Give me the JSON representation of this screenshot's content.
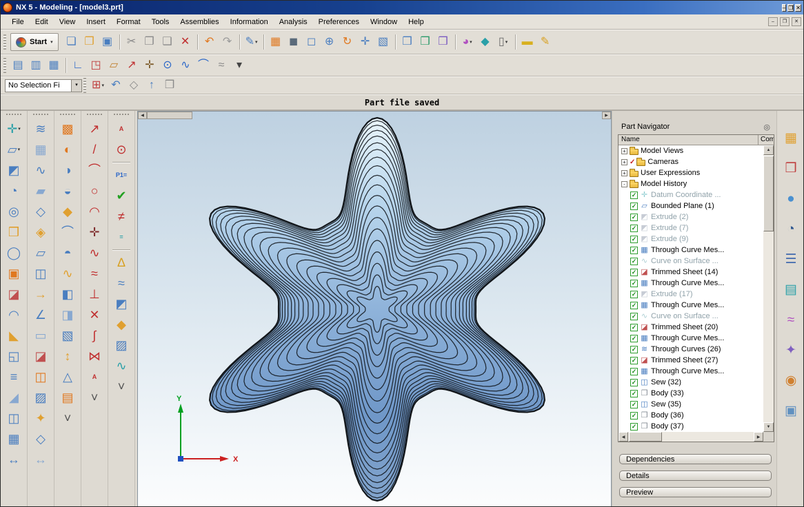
{
  "titlebar": {
    "title": "NX 5 - Modeling - [model3.prt]",
    "window_buttons": [
      {
        "n": "minimize-button",
        "g": "–"
      },
      {
        "n": "maximize-button",
        "g": "❐"
      },
      {
        "n": "close-button",
        "g": "✕"
      }
    ]
  },
  "menubar": {
    "items": [
      "File",
      "Edit",
      "View",
      "Insert",
      "Format",
      "Tools",
      "Assemblies",
      "Information",
      "Analysis",
      "Preferences",
      "Window",
      "Help"
    ],
    "child_buttons": [
      {
        "n": "child-minimize-button",
        "g": "–"
      },
      {
        "n": "child-restore-button",
        "g": "❐"
      },
      {
        "n": "child-close-button",
        "g": "✕"
      }
    ]
  },
  "toolbar_main": {
    "start_label": "Start",
    "start_arrow": "▾",
    "icons": [
      {
        "n": "new-file",
        "g": "❏",
        "c": "#4a7ec0"
      },
      {
        "n": "open-file",
        "g": "❐",
        "c": "#e0a030"
      },
      {
        "n": "save",
        "g": "▣",
        "c": "#4a7ec0"
      },
      {
        "sep": true
      },
      {
        "n": "cut",
        "g": "✂",
        "c": "#8a8a8a"
      },
      {
        "n": "copy",
        "g": "❐",
        "c": "#8a8a8a"
      },
      {
        "n": "paste",
        "g": "❑",
        "c": "#8a8a8a"
      },
      {
        "n": "delete",
        "g": "✕",
        "c": "#c03030"
      },
      {
        "sep": true
      },
      {
        "n": "undo",
        "g": "↶",
        "c": "#e07820"
      },
      {
        "n": "redo",
        "g": "↷",
        "c": "#9a9a9a"
      },
      {
        "sep": true
      },
      {
        "n": "direct-sketch",
        "g": "✎",
        "c": "#4a7ec0",
        "d": true
      },
      {
        "sep": true
      },
      {
        "n": "object-display",
        "g": "▦",
        "c": "#e07820"
      },
      {
        "n": "shaded-display",
        "g": "◼",
        "c": "#5a6a7a"
      },
      {
        "n": "zoom-window",
        "g": "◻",
        "c": "#4a7ec0"
      },
      {
        "n": "zoom-in-out",
        "g": "⊕",
        "c": "#4a7ec0"
      },
      {
        "n": "rotate-view",
        "g": "↻",
        "c": "#e07820"
      },
      {
        "n": "pan-view",
        "g": "✛",
        "c": "#4a7ec0"
      },
      {
        "n": "fit-view",
        "g": "▧",
        "c": "#4a7ec0"
      },
      {
        "sep": true
      },
      {
        "n": "assembly-constraints",
        "g": "❒",
        "c": "#4a7ec0"
      },
      {
        "n": "move-component",
        "g": "❒",
        "c": "#2a9a6a"
      },
      {
        "n": "add-component",
        "g": "❒",
        "c": "#7a5ac0"
      },
      {
        "sep": true
      },
      {
        "n": "rendering-style",
        "g": "◕",
        "c": "#b050c0",
        "d": true
      },
      {
        "n": "shaded-solid",
        "g": "◆",
        "c": "#2aa0a8"
      },
      {
        "n": "display-mode",
        "g": "▯",
        "c": "#6a6a6a",
        "d": true
      },
      {
        "sep": true
      },
      {
        "n": "measure-distance",
        "g": "▬",
        "c": "#d8b020"
      },
      {
        "n": "simple-interference",
        "g": "✎",
        "c": "#d8a020"
      }
    ]
  },
  "toolbar_second": {
    "icons": [
      {
        "n": "view-layout-one",
        "g": "▤",
        "c": "#4a7ec0"
      },
      {
        "n": "view-layout-two",
        "g": "▥",
        "c": "#4a7ec0"
      },
      {
        "n": "view-layout-four",
        "g": "▦",
        "c": "#4a7ec0"
      },
      {
        "sep": true
      },
      {
        "n": "sketch",
        "g": "∟",
        "c": "#2a66c8"
      },
      {
        "n": "sketch-in-task",
        "g": "◳",
        "c": "#c04040"
      },
      {
        "n": "datum-plane",
        "g": "▱",
        "c": "#c08030"
      },
      {
        "n": "datum-axis",
        "g": "↗",
        "c": "#c03030"
      },
      {
        "n": "point",
        "g": "✛",
        "c": "#806030"
      },
      {
        "n": "point-origin",
        "g": "⊙",
        "c": "#2a66c8"
      },
      {
        "n": "studio-spline",
        "g": "∿",
        "c": "#2a66c8"
      },
      {
        "n": "arc",
        "g": "⌒",
        "c": "#2a66c8"
      },
      {
        "n": "offset-curve",
        "g": "≈",
        "c": "#8a8a8a"
      },
      {
        "n": "more-curve-tools",
        "g": "▾",
        "c": "#444444"
      }
    ]
  },
  "selection_bar": {
    "filter_value": "No Selection Fi",
    "combo_arrow": "▾",
    "icons": [
      {
        "n": "snap-point",
        "g": "⊞",
        "c": "#c04040",
        "d": true
      },
      {
        "n": "undo-selection",
        "g": "↶",
        "c": "#4a7ec0"
      },
      {
        "n": "work-section",
        "g": "◇",
        "c": "#8a8a8a"
      },
      {
        "n": "orient-view",
        "g": "↑",
        "c": "#4a7ec0"
      },
      {
        "n": "selection-scope",
        "g": "❒",
        "c": "#8a8a8a"
      }
    ]
  },
  "status_bar": {
    "message": "Part file saved"
  },
  "toolbox": {
    "columns": [
      {
        "icons": [
          {
            "n": "datum-csys",
            "g": "✛",
            "c": "#2aa0a8",
            "d": true
          },
          {
            "n": "sketch-feature",
            "g": "▱",
            "c": "#4a7ec0",
            "d": true
          },
          {
            "n": "extrude",
            "g": "◩",
            "c": "#4a7ec0"
          },
          {
            "n": "revolve",
            "g": "◔",
            "c": "#4a7ec0"
          },
          {
            "n": "hole",
            "g": "◎",
            "c": "#4a7ec0"
          },
          {
            "n": "block",
            "g": "❒",
            "c": "#e0a030"
          },
          {
            "n": "cylinder",
            "g": "◯",
            "c": "#4a7ec0"
          },
          {
            "n": "unite",
            "g": "▣",
            "c": "#e07820"
          },
          {
            "n": "subtract",
            "g": "◪",
            "c": "#c05050"
          },
          {
            "n": "edge-blend",
            "g": "◠",
            "c": "#4a7ec0"
          },
          {
            "n": "chamfer",
            "g": "◣",
            "c": "#e0a030"
          },
          {
            "n": "shell",
            "g": "◱",
            "c": "#4a7ec0"
          },
          {
            "n": "thicken",
            "g": "≡",
            "c": "#4a7ec0"
          },
          {
            "n": "draft",
            "g": "◢",
            "c": "#88a8d0"
          },
          {
            "n": "mirror-feature",
            "g": "◫",
            "c": "#4a7ec0"
          },
          {
            "n": "pattern-feature",
            "g": "▦",
            "c": "#4a7ec0"
          },
          {
            "n": "move-face",
            "g": "↔",
            "c": "#4a7ec0"
          }
        ]
      },
      {
        "icons": [
          {
            "n": "through-curves",
            "g": "≋",
            "c": "#4a7ec0"
          },
          {
            "n": "through-curve-mesh",
            "g": "▦",
            "c": "#88a8d0"
          },
          {
            "n": "swept",
            "g": "∿",
            "c": "#4a7ec0"
          },
          {
            "n": "ruled-surface",
            "g": "▰",
            "c": "#88a8d0"
          },
          {
            "n": "n-sided-surface",
            "g": "◇",
            "c": "#4a7ec0"
          },
          {
            "n": "studio-surface",
            "g": "◈",
            "c": "#e0a030"
          },
          {
            "n": "bounded-plane",
            "g": "▱",
            "c": "#4a7ec0"
          },
          {
            "n": "offset-surface",
            "g": "◫",
            "c": "#4a7ec0"
          },
          {
            "n": "extension-surface",
            "g": "→",
            "c": "#e0a030"
          },
          {
            "n": "law-extension",
            "g": "∠",
            "c": "#4a7ec0"
          },
          {
            "n": "sheet-body",
            "g": "▭",
            "c": "#88a8d0"
          },
          {
            "n": "trimmed-sheet",
            "g": "◪",
            "c": "#c05050"
          },
          {
            "n": "sew",
            "g": "◫",
            "c": "#e07820"
          },
          {
            "n": "patch-body",
            "g": "▨",
            "c": "#4a7ec0"
          },
          {
            "n": "x-form",
            "g": "✦",
            "c": "#e0a030"
          },
          {
            "n": "i-form",
            "g": "◇",
            "c": "#4a7ec0"
          },
          {
            "n": "edge-symmetry",
            "g": "↔",
            "c": "#88a8d0"
          }
        ]
      },
      {
        "icons": [
          {
            "n": "fill-surface",
            "g": "▩",
            "c": "#e07820"
          },
          {
            "n": "face-blend",
            "g": "◐",
            "c": "#e07820"
          },
          {
            "n": "styled-blend",
            "g": "◑",
            "c": "#4a7ec0"
          },
          {
            "n": "soft-blend",
            "g": "◒",
            "c": "#4a7ec0"
          },
          {
            "n": "styled-corner",
            "g": "◆",
            "c": "#e0a030"
          },
          {
            "n": "silhouette-flange",
            "g": "⌒",
            "c": "#4a7ec0"
          },
          {
            "n": "global-shaping",
            "g": "◓",
            "c": "#4a7ec0"
          },
          {
            "n": "swoop",
            "g": "∿",
            "c": "#e0a030"
          },
          {
            "n": "emboss-body",
            "g": "◧",
            "c": "#4a7ec0"
          },
          {
            "n": "offset-emboss",
            "g": "◨",
            "c": "#88a8d0"
          },
          {
            "n": "refit-face",
            "g": "▧",
            "c": "#4a7ec0"
          },
          {
            "n": "scale-body",
            "g": "↕",
            "c": "#e0a030"
          },
          {
            "n": "wrap-geometry",
            "g": "△",
            "c": "#4a7ec0"
          },
          {
            "n": "quilt",
            "g": "▤",
            "c": "#e07820"
          },
          {
            "n": "more-surface-tools",
            "g": "˅",
            "c": "#555555"
          }
        ]
      },
      {
        "icons": [
          {
            "n": "profile",
            "g": "↗",
            "c": "#c03030"
          },
          {
            "n": "line",
            "g": "/",
            "c": "#c03030"
          },
          {
            "n": "arc-circle",
            "g": "⌒",
            "c": "#c03030"
          },
          {
            "n": "circle",
            "g": "○",
            "c": "#c03030"
          },
          {
            "n": "fillet",
            "g": "◠",
            "c": "#c03030"
          },
          {
            "n": "point-on-curve",
            "g": "✛",
            "c": "#803030"
          },
          {
            "n": "spline",
            "g": "∿",
            "c": "#c03030"
          },
          {
            "n": "offset-curve-tool",
            "g": "≈",
            "c": "#c03030"
          },
          {
            "n": "project-curve",
            "g": "⊥",
            "c": "#c03030"
          },
          {
            "n": "intersection-curve",
            "g": "✕",
            "c": "#c03030"
          },
          {
            "n": "section-curve",
            "g": "∫",
            "c": "#c03030"
          },
          {
            "n": "join-curve",
            "g": "⋈",
            "c": "#c03030"
          },
          {
            "n": "text-curve",
            "g": "A",
            "c": "#c03030",
            "t": true
          },
          {
            "n": "more-curve-tools-column",
            "g": "˅",
            "c": "#555555"
          }
        ]
      },
      {
        "icons": [
          {
            "n": "annotation-text",
            "g": "A",
            "c": "#c03030",
            "t": true
          },
          {
            "n": "point-tool",
            "g": "⊙",
            "c": "#c03030"
          },
          {
            "sep": true
          },
          {
            "n": "expression",
            "g": "P1=",
            "c": "#2a66c8",
            "t": true
          },
          {
            "n": "expression-check",
            "g": "✔",
            "c": "#22a020"
          },
          {
            "n": "requirement-unmet",
            "g": "≠",
            "c": "#c03030"
          },
          {
            "n": "equal-constraint",
            "g": "=",
            "c": "#2aa0a8",
            "t": true
          },
          {
            "sep": true
          },
          {
            "n": "measure-body",
            "g": "∆",
            "c": "#d8a020"
          },
          {
            "n": "deviation-gauge",
            "g": "≈",
            "c": "#4a7ec0"
          },
          {
            "n": "reflection-analysis",
            "g": "◩",
            "c": "#4a7ec0"
          },
          {
            "n": "draft-analysis",
            "g": "◆",
            "c": "#e0a030"
          },
          {
            "n": "face-analysis",
            "g": "▨",
            "c": "#4a7ec0"
          },
          {
            "n": "curve-analysis",
            "g": "∿",
            "c": "#2aa0a8"
          },
          {
            "n": "more-analysis-tools",
            "g": "˅",
            "c": "#555555"
          }
        ]
      }
    ]
  },
  "viewport": {
    "axes": {
      "x": "X",
      "y": "Y"
    },
    "pane_arrows": {
      "left": "◀",
      "right": "▶"
    }
  },
  "navigator": {
    "title": "Part Navigator",
    "pin_icon": "◎",
    "columns": [
      "Name",
      "Com"
    ],
    "scroll": {
      "up": "▲",
      "down": "▼",
      "left": "◀",
      "right": "▶"
    },
    "tree": [
      {
        "n": "tree-model-views",
        "label": "Model Views",
        "level": 0,
        "expand": "+",
        "g": "folder"
      },
      {
        "n": "tree-cameras",
        "label": "Cameras",
        "level": 0,
        "expand": "+",
        "check": "red",
        "g": "folder"
      },
      {
        "n": "tree-user-expressions",
        "label": "User Expressions",
        "level": 0,
        "expand": "+",
        "g": "folder"
      },
      {
        "n": "tree-model-history",
        "label": "Model History",
        "level": 0,
        "expand": "-",
        "g": "folder-open"
      },
      {
        "n": "tree-datum-coordinate",
        "label": "Datum Coordinate ...",
        "level": 1,
        "check": "green",
        "g": "✛",
        "c": "#2aa0a8",
        "gray": true
      },
      {
        "n": "tree-bounded-plane-1",
        "label": "Bounded Plane (1)",
        "level": 1,
        "check": "green",
        "g": "▱",
        "c": "#4a7ec0"
      },
      {
        "n": "tree-extrude-2",
        "label": "Extrude (2)",
        "level": 1,
        "check": "green",
        "g": "◩",
        "c": "#9aa4b4",
        "gray": true
      },
      {
        "n": "tree-extrude-7",
        "label": "Extrude (7)",
        "level": 1,
        "check": "green",
        "g": "◩",
        "c": "#9aa4b4",
        "gray": true
      },
      {
        "n": "tree-extrude-9",
        "label": "Extrude (9)",
        "level": 1,
        "check": "green",
        "g": "◩",
        "c": "#9aa4b4",
        "gray": true
      },
      {
        "n": "tree-through-curve-mesh-a",
        "label": "Through Curve Mes...",
        "level": 1,
        "check": "green",
        "g": "▦",
        "c": "#4a7ec0"
      },
      {
        "n": "tree-curve-on-surface-a",
        "label": "Curve on Surface ...",
        "level": 1,
        "check": "green",
        "g": "∿",
        "c": "#6aa8b0",
        "gray": true
      },
      {
        "n": "tree-trimmed-sheet-14",
        "label": "Trimmed Sheet (14)",
        "level": 1,
        "check": "green",
        "g": "◪",
        "c": "#c05050"
      },
      {
        "n": "tree-through-curve-mesh-b",
        "label": "Through Curve Mes...",
        "level": 1,
        "check": "green",
        "g": "▦",
        "c": "#4a7ec0"
      },
      {
        "n": "tree-extrude-17",
        "label": "Extrude (17)",
        "level": 1,
        "check": "green",
        "g": "◩",
        "c": "#9aa4b4",
        "gray": true
      },
      {
        "n": "tree-through-curve-mesh-c",
        "label": "Through Curve Mes...",
        "level": 1,
        "check": "green",
        "g": "▦",
        "c": "#4a7ec0"
      },
      {
        "n": "tree-curve-on-surface-b",
        "label": "Curve on Surface ...",
        "level": 1,
        "check": "green",
        "g": "∿",
        "c": "#6aa8b0",
        "gray": true
      },
      {
        "n": "tree-trimmed-sheet-20",
        "label": "Trimmed Sheet (20)",
        "level": 1,
        "check": "green",
        "g": "◪",
        "c": "#c05050"
      },
      {
        "n": "tree-through-curve-mesh-d",
        "label": "Through Curve Mes...",
        "level": 1,
        "check": "green",
        "g": "▦",
        "c": "#4a7ec0"
      },
      {
        "n": "tree-through-curves-26",
        "label": "Through Curves (26)",
        "level": 1,
        "check": "green",
        "g": "≋",
        "c": "#4a7ec0"
      },
      {
        "n": "tree-trimmed-sheet-27",
        "label": "Trimmed Sheet (27)",
        "level": 1,
        "check": "green",
        "g": "◪",
        "c": "#c05050"
      },
      {
        "n": "tree-through-curve-mesh-e",
        "label": "Through Curve Mes...",
        "level": 1,
        "check": "green",
        "g": "▦",
        "c": "#4a7ec0"
      },
      {
        "n": "tree-sew-32",
        "label": "Sew (32)",
        "level": 1,
        "check": "green",
        "g": "◫",
        "c": "#4a7ec0"
      },
      {
        "n": "tree-body-33",
        "label": "Body (33)",
        "level": 1,
        "check": "green",
        "g": "❒",
        "c": "#808890"
      },
      {
        "n": "tree-sew-35",
        "label": "Sew (35)",
        "level": 1,
        "check": "green",
        "g": "◫",
        "c": "#4a7ec0"
      },
      {
        "n": "tree-body-36",
        "label": "Body (36)",
        "level": 1,
        "check": "green",
        "g": "❒",
        "c": "#808890"
      },
      {
        "n": "tree-body-37",
        "label": "Body (37)",
        "level": 1,
        "check": "green",
        "g": "❒",
        "c": "#808890"
      }
    ],
    "panels": [
      "Dependencies",
      "Details",
      "Preview"
    ]
  },
  "right_strip": {
    "icons": [
      {
        "n": "roles-palette",
        "g": "▦",
        "c": "#e0a030"
      },
      {
        "n": "visualization-palette",
        "g": "❒",
        "c": "#c04040"
      },
      {
        "n": "material-palette",
        "g": "●",
        "c": "#4a90d0"
      },
      {
        "n": "history-palette",
        "g": "◔",
        "c": "#305890"
      },
      {
        "n": "system-materials",
        "g": "☰",
        "c": "#4a70b0"
      },
      {
        "n": "information-palette",
        "g": "▤",
        "c": "#2aa0a8"
      },
      {
        "n": "color-palette",
        "g": "≈",
        "c": "#b050c0"
      },
      {
        "n": "render-tools",
        "g": "✦",
        "c": "#8060c0"
      },
      {
        "n": "people-palette",
        "g": "◉",
        "c": "#d08030"
      },
      {
        "n": "image-gallery",
        "g": "▣",
        "c": "#6090c0"
      }
    ]
  }
}
